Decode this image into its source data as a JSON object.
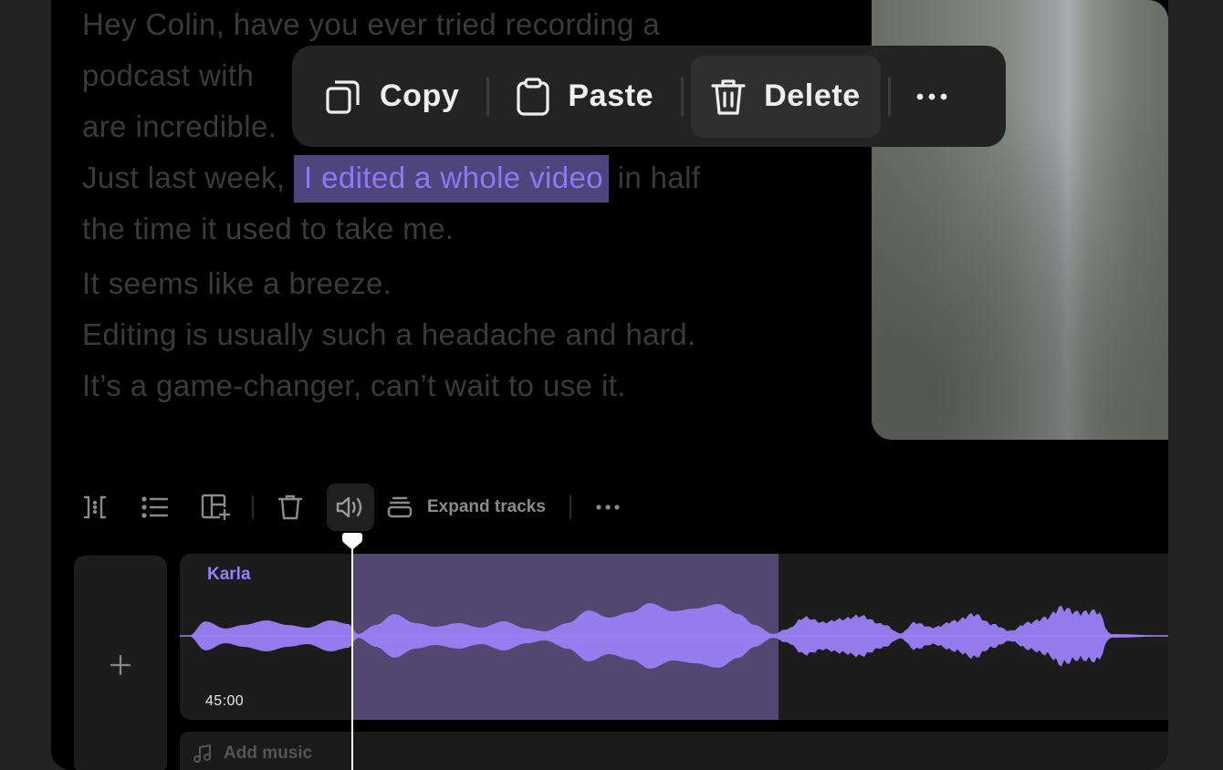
{
  "transcript": {
    "line1": "Hey Colin, have you ever tried recording a",
    "line2": "podcast with",
    "line3": "are incredible.",
    "line4_before": "Just last week, ",
    "line4_highlight": "I edited a whole video",
    "line4_after": " in half",
    "line5": "the time it used to take me.",
    "line6": "It seems like a breeze.",
    "line7": "Editing is usually such a headache and hard.",
    "line8": "It’s a game-changer, can’t wait to use it."
  },
  "context_menu": {
    "copy_label": "Copy",
    "paste_label": "Paste",
    "delete_label": "Delete"
  },
  "toolbar": {
    "expand_label": "Expand tracks"
  },
  "track": {
    "speaker": "Karla",
    "duration": "45:00"
  },
  "music": {
    "add_label": "Add music"
  },
  "colors": {
    "accent": "#9b7ff7",
    "selection": "#524770",
    "highlight_bg": "#4f457d",
    "highlight_text": "#8f78f5"
  },
  "icons": [
    "copy-icon",
    "paste-icon",
    "trash-icon",
    "more-icon",
    "split-icon",
    "list-icon",
    "layout-add-icon",
    "volume-icon",
    "stack-icon",
    "plus-icon",
    "music-note-icon",
    "playhead-icon"
  ]
}
